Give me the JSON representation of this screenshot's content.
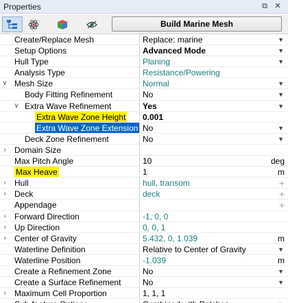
{
  "window": {
    "title": "Properties",
    "pin_icon": "pin-icon",
    "close_icon": "close-icon"
  },
  "toolbar": {
    "tabs": [
      {
        "icon": "hierarchy-icon"
      },
      {
        "icon": "atom-icon"
      },
      {
        "icon": "cube-icon"
      },
      {
        "icon": "eye-icon"
      }
    ],
    "build_label": "Build Marine Mesh"
  },
  "rows": [
    {
      "name": "Create/Replace Mesh",
      "value": "Replace: marine",
      "indent": 0,
      "dropdown": true
    },
    {
      "name": "Setup Options",
      "value": "Advanced Mode",
      "indent": 0,
      "bold": true,
      "dropdown": true
    },
    {
      "name": "Hull Type",
      "value": "Planing",
      "indent": 0,
      "teal": true,
      "dropdown": true
    },
    {
      "name": "Analysis Type",
      "value": "Resistance/Powering",
      "indent": 0,
      "teal": true
    },
    {
      "name": "Mesh Size",
      "value": "Normal",
      "indent": 0,
      "expander": "down",
      "teal": true,
      "dropdown": true
    },
    {
      "name": "Body Fitting Refinement",
      "value": "No",
      "indent": 1,
      "dropdown": true
    },
    {
      "name": "Extra Wave Refinement",
      "value": "Yes",
      "indent": 1,
      "expander": "down",
      "bold": true,
      "dropdown": true
    },
    {
      "name": "Extra Wave Zone Height",
      "value": "0.001",
      "indent": 2,
      "bold": true,
      "highlight": "yellow"
    },
    {
      "name": "Extra Wave Zone Extension",
      "value": "No",
      "indent": 2,
      "highlight": "selected",
      "dropdown": true
    },
    {
      "name": "Deck Zone Refinement",
      "value": "No",
      "indent": 1,
      "dropdown": true
    },
    {
      "name": "Domain Size",
      "value": "",
      "indent": 0,
      "expander": "right"
    },
    {
      "name": "Max Pitch Angle",
      "value": "10",
      "indent": 0,
      "unit": "deg"
    },
    {
      "name": "Max Heave",
      "value": "1",
      "indent": 0,
      "highlight": "yellow",
      "unit": "m"
    },
    {
      "name": "Hull",
      "value": "hull, transom",
      "indent": 0,
      "expander": "right",
      "teal": true,
      "plus": true
    },
    {
      "name": "Deck",
      "value": "deck",
      "indent": 0,
      "expander": "right",
      "teal": true,
      "plus": true
    },
    {
      "name": "Appendage",
      "value": "",
      "indent": 0,
      "plus": true
    },
    {
      "name": "Forward Direction",
      "value": "-1, 0, 0",
      "indent": 0,
      "expander": "right",
      "teal": true
    },
    {
      "name": "Up Direction",
      "value": "0, 0, 1",
      "indent": 0,
      "expander": "right",
      "teal": true
    },
    {
      "name": "Center of Gravity",
      "value": "5.432, 0, 1.039",
      "indent": 0,
      "expander": "right",
      "teal": true,
      "unit": "m"
    },
    {
      "name": "Waterline Definition",
      "value": "Relative to Center of Gravity",
      "indent": 0,
      "dropdown": true
    },
    {
      "name": "Waterline Position",
      "value": "-1.039",
      "indent": 0,
      "teal": true,
      "unit": "m"
    },
    {
      "name": "Create a Refinement Zone",
      "value": "No",
      "indent": 0,
      "dropdown": true
    },
    {
      "name": "Create a Surface Refinement",
      "value": "No",
      "indent": 0,
      "dropdown": true
    },
    {
      "name": "Maximum Cell Proportion",
      "value": "1, 1, 1",
      "indent": 0,
      "expander": "right"
    },
    {
      "name": "Sub-feature Options",
      "value": "Combined with Patches",
      "indent": 0,
      "dropdown": true
    }
  ]
}
